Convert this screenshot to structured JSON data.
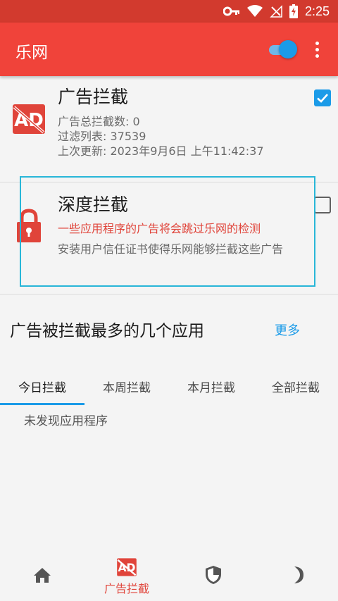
{
  "status_bar": {
    "time": "2:25",
    "icons": [
      "key-icon",
      "wifi-icon",
      "no-signal-icon",
      "battery-charging-icon"
    ]
  },
  "app_bar": {
    "title": "乐网",
    "toggle_on": true,
    "colors": {
      "background": "#f0433a",
      "accent": "#1b9be8"
    }
  },
  "ad_block": {
    "title": "广告拦截",
    "total_blocked": "广告总拦截数: 0",
    "filter_list": "过滤列表: 37539",
    "last_updated": "上次更新: 2023年9月6日  上午11:42:37",
    "checked": true,
    "icon": "ad-block-icon"
  },
  "deep_block": {
    "title": "深度拦截",
    "warning": "一些应用程序的广告将会跳过乐网的检测",
    "description": "安装用户信任证书使得乐网能够拦截这些广告",
    "checked": false,
    "icon": "lock-icon"
  },
  "top_apps": {
    "heading": "广告被拦截最多的几个应用",
    "more": "更多",
    "tabs": [
      "今日拦截",
      "本周拦截",
      "本月拦截",
      "全部拦截"
    ],
    "active_tab": 0,
    "empty_message": "未发现应用程序"
  },
  "bottom_nav": {
    "items": [
      {
        "icon": "home-icon",
        "label": ""
      },
      {
        "icon": "ad-block-icon",
        "label": "广告拦截"
      },
      {
        "icon": "shield-icon",
        "label": ""
      },
      {
        "icon": "moon-icon",
        "label": ""
      }
    ],
    "active": 1
  }
}
